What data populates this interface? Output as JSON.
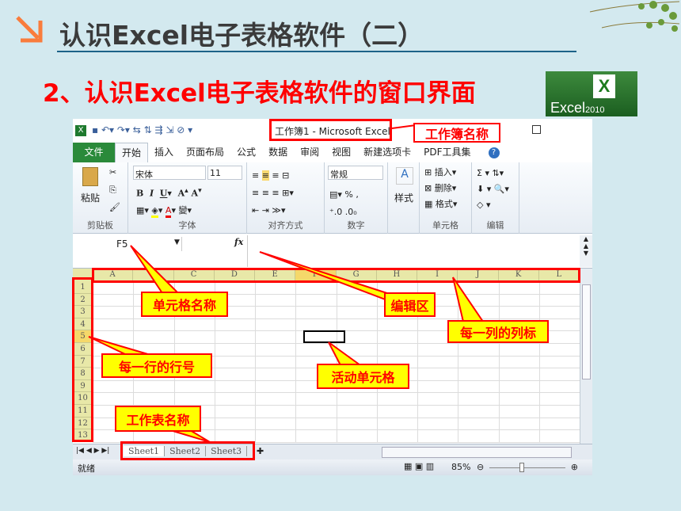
{
  "slide": {
    "title": "认识Excel电子表格软件（二）",
    "subtitle": "2、认识Excel电子表格软件的窗口界面",
    "logo_text": "Microsoft Excel 2010",
    "accent": "#f97c3c"
  },
  "excel": {
    "window_title": "工作簿1 - Microsoft Excel",
    "tabs": [
      "文件",
      "开始",
      "插入",
      "页面布局",
      "公式",
      "数据",
      "审阅",
      "视图",
      "新建选项卡",
      "PDF工具集"
    ],
    "ribbon": {
      "clipboard": {
        "paste": "粘贴",
        "label": "剪贴板"
      },
      "font": {
        "name": "宋体",
        "size": "11",
        "label": "字体"
      },
      "align": {
        "label": "对齐方式"
      },
      "number": {
        "format": "常规",
        "label": "数字"
      },
      "styles": {
        "button": "样式"
      },
      "cells": {
        "insert": "插入",
        "delete": "删除",
        "format": "格式",
        "label": "单元格"
      },
      "edit": {
        "label": "编辑"
      }
    },
    "name_box": "F5",
    "fx": "fx",
    "columns": [
      "A",
      "B",
      "C",
      "D",
      "E",
      "F",
      "G",
      "H",
      "I",
      "J",
      "K",
      "L"
    ],
    "rows": [
      "1",
      "2",
      "3",
      "4",
      "5",
      "6",
      "7",
      "8",
      "9",
      "10",
      "11",
      "12",
      "13"
    ],
    "active_cell": "F5",
    "sheets": [
      "Sheet1",
      "Sheet2",
      "Sheet3"
    ],
    "status": "就绪",
    "zoom": "85%"
  },
  "callouts": {
    "workbook_name": "工作簿名称",
    "cell_name": "单元格名称",
    "edit_area": "编辑区",
    "column_labels": "每一列的列标",
    "row_numbers": "每一行的行号",
    "active_cell": "活动单元格",
    "sheet_name": "工作表名称"
  }
}
